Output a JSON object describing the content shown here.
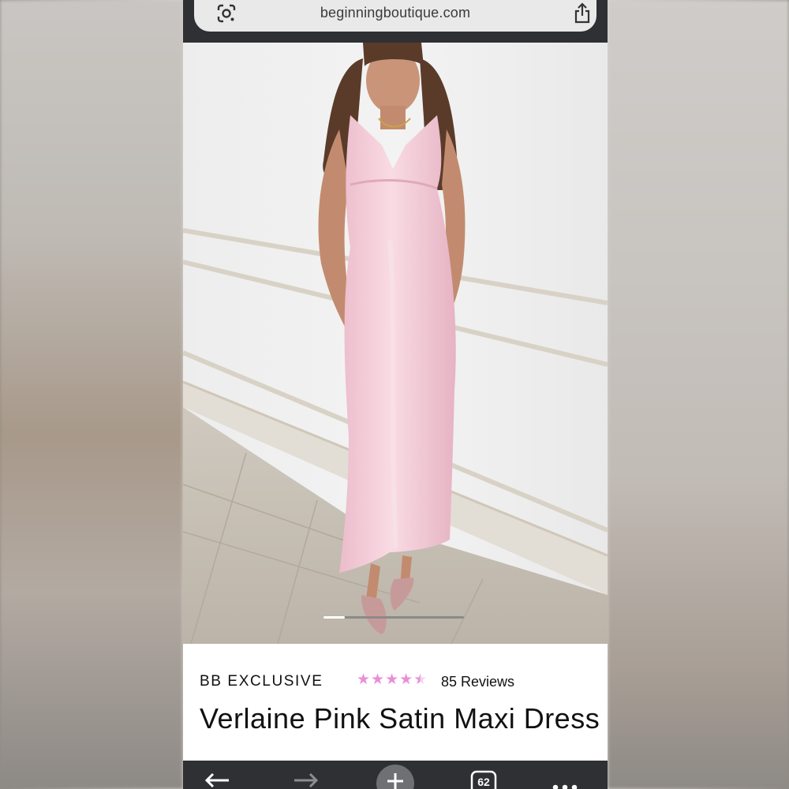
{
  "browser": {
    "url": "beginningboutique.com",
    "tab_count": "62",
    "icons": [
      "google-lens-icon",
      "share-icon",
      "back-arrow-icon",
      "forward-arrow-icon",
      "new-tab-plus-icon",
      "tabs-icon",
      "more-icon"
    ]
  },
  "product": {
    "brand_label": "BB EXCLUSIVE",
    "rating": 4.5,
    "rating_max": 5,
    "reviews_label": "85 Reviews",
    "title": "Verlaine Pink Satin Maxi Dress"
  },
  "carousel": {
    "current_index": 1,
    "total": 7
  },
  "colors": {
    "star": "#e88fd8",
    "dress": "#f2c9d4",
    "bar": "#2e3033"
  }
}
